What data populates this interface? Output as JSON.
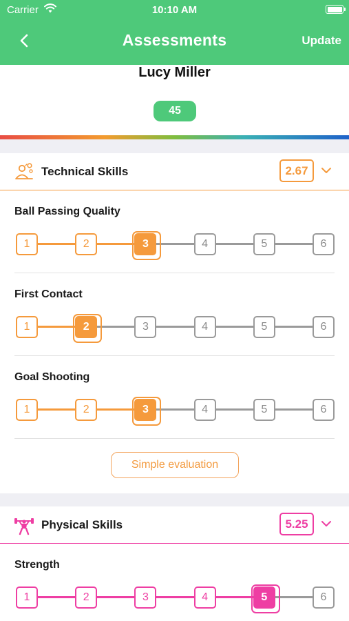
{
  "status_bar": {
    "carrier": "Carrier",
    "time": "10:10 AM"
  },
  "nav": {
    "title": "Assessments",
    "update_label": "Update"
  },
  "profile": {
    "name": "Lucy Miller",
    "score": "45"
  },
  "sections": [
    {
      "id": "technical",
      "title": "Technical Skills",
      "average": "2.67",
      "icon": "technical-skills-icon",
      "color": "#f59a3c",
      "skills": [
        {
          "name": "Ball Passing Quality",
          "value": 3
        },
        {
          "name": "First Contact",
          "value": 2
        },
        {
          "name": "Goal Shooting",
          "value": 3
        }
      ],
      "button_label": "Simple evaluation"
    },
    {
      "id": "physical",
      "title": "Physical Skills",
      "average": "5.25",
      "icon": "weightlifter-icon",
      "color": "#ee3ea3",
      "skills": [
        {
          "name": "Strength",
          "value": 5
        }
      ]
    }
  ],
  "scale": {
    "levels": [
      "1",
      "2",
      "3",
      "4",
      "5",
      "6"
    ],
    "inactive_color": "#9a9a9a"
  }
}
